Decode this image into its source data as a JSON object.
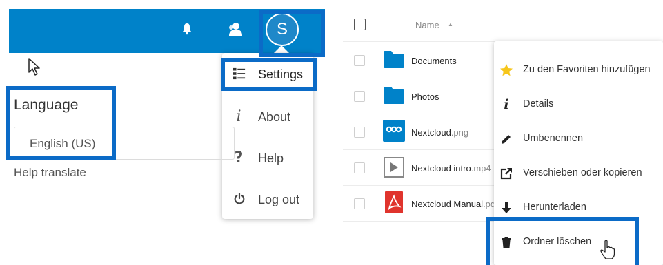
{
  "settings_page": {
    "user_menu": {
      "avatar_initial": "S",
      "items": [
        {
          "label": "Settings",
          "icon": "settings-list-icon"
        },
        {
          "label": "About",
          "icon": "info-icon"
        },
        {
          "label": "Help",
          "icon": "help-icon"
        },
        {
          "label": "Log out",
          "icon": "power-icon"
        }
      ]
    },
    "language": {
      "title": "Language",
      "selected": "English (US)",
      "help_translate": "Help translate"
    }
  },
  "files": {
    "header": {
      "name_label": "Name",
      "sort_indicator": "▲"
    },
    "rows": [
      {
        "name": "Documents",
        "ext": "",
        "type": "folder"
      },
      {
        "name": "Photos",
        "ext": "",
        "type": "folder"
      },
      {
        "name": "Nextcloud",
        "ext": ".png",
        "type": "image"
      },
      {
        "name": "Nextcloud intro",
        "ext": ".mp4",
        "type": "video"
      },
      {
        "name": "Nextcloud Manual",
        "ext": ".pdf",
        "type": "pdf"
      }
    ],
    "context_menu": [
      {
        "label": "Zu den Favoriten hinzufügen",
        "icon": "star-icon"
      },
      {
        "label": "Details",
        "icon": "info-icon"
      },
      {
        "label": "Umbenennen",
        "icon": "pencil-icon"
      },
      {
        "label": "Verschieben oder kopieren",
        "icon": "external-link-icon"
      },
      {
        "label": "Herunterladen",
        "icon": "download-icon"
      },
      {
        "label": "Ordner löschen",
        "icon": "trash-icon"
      }
    ]
  },
  "colors": {
    "header_blue": "#0082c9",
    "highlight_blue": "#0b6bc7",
    "folder_blue": "#0082c9",
    "pdf_red": "#e0342d",
    "star_yellow": "#f6c61b"
  }
}
